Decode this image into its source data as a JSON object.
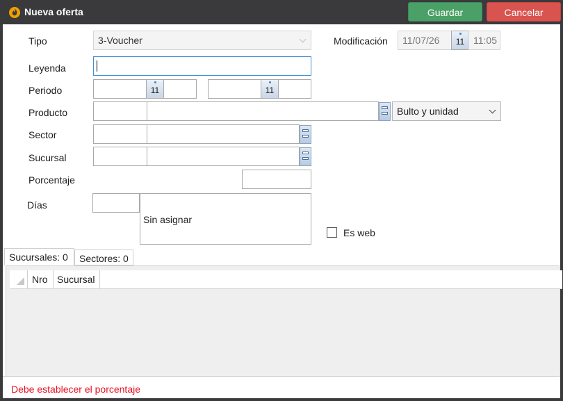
{
  "window": {
    "title": "Nueva oferta"
  },
  "toolbar": {
    "save_label": "Guardar",
    "cancel_label": "Cancelar"
  },
  "form": {
    "tipo_label": "Tipo",
    "tipo_value": "3-Voucher",
    "modificacion_label": "Modificación",
    "modificacion_date": "11/07/26",
    "modificacion_time": "11:05",
    "calendar_day": "11",
    "leyenda_label": "Leyenda",
    "leyenda_value": "",
    "periodo_label": "Periodo",
    "producto_label": "Producto",
    "producto_unit": "Bulto y unidad",
    "sector_label": "Sector",
    "sucursal_label": "Sucursal",
    "porcentaje_label": "Porcentaje",
    "dias_label": "Días",
    "dias_text": "Sin asignar",
    "es_web_label": "Es web"
  },
  "tabs": [
    {
      "label": "Sucursales: 0"
    },
    {
      "label": "Sectores: 0"
    }
  ],
  "grid": {
    "columns": [
      "Nro",
      "Sucursal"
    ]
  },
  "status": {
    "message": "Debe establecer el porcentaje",
    "color": "#e81123"
  },
  "colors": {
    "save": "#4aa066",
    "cancel": "#d9534f",
    "titlebar": "#3a3a3c"
  }
}
